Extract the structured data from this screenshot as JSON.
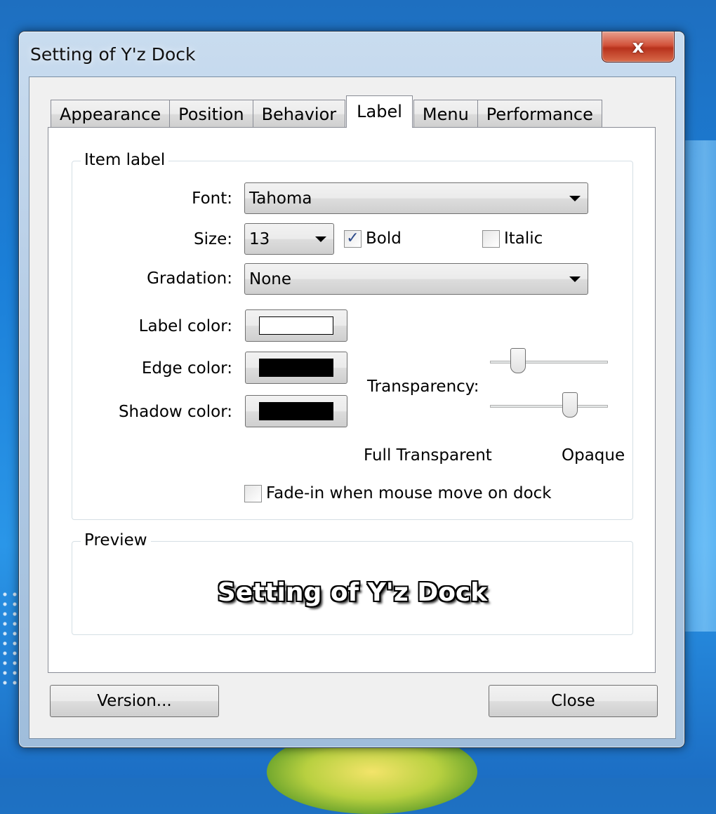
{
  "window": {
    "title": "Setting of Y'z Dock",
    "close_glyph": "x"
  },
  "tabs": [
    {
      "label": "Appearance",
      "active": false
    },
    {
      "label": "Position",
      "active": false
    },
    {
      "label": "Behavior",
      "active": false
    },
    {
      "label": "Label",
      "active": true
    },
    {
      "label": "Menu",
      "active": false
    },
    {
      "label": "Performance",
      "active": false
    }
  ],
  "item_label": {
    "group_title": "Item label",
    "font_label": "Font:",
    "font_value": "Tahoma",
    "size_label": "Size:",
    "size_value": "13",
    "bold_label": "Bold",
    "bold_checked": true,
    "italic_label": "Italic",
    "italic_checked": false,
    "gradation_label": "Gradation:",
    "gradation_value": "None",
    "label_color_label": "Label color:",
    "label_color": "#ffffff",
    "edge_color_label": "Edge color:",
    "edge_color": "#000000",
    "shadow_color_label": "Shadow color:",
    "shadow_color": "#000000",
    "transparency_label": "Transparency:",
    "transparency_edge_fraction": 0.24,
    "transparency_shadow_fraction": 0.68,
    "full_transparent_label": "Full Transparent",
    "opaque_label": "Opaque",
    "fade_in_label": "Fade-in when mouse move on dock",
    "fade_in_checked": false
  },
  "preview": {
    "group_title": "Preview",
    "sample_text": "Setting of Y'z Dock"
  },
  "footer": {
    "version_label": "Version...",
    "close_label": "Close"
  },
  "icons": {
    "close": "close-icon",
    "dropdown": "chevron-down-icon",
    "check": "checkmark-icon"
  }
}
